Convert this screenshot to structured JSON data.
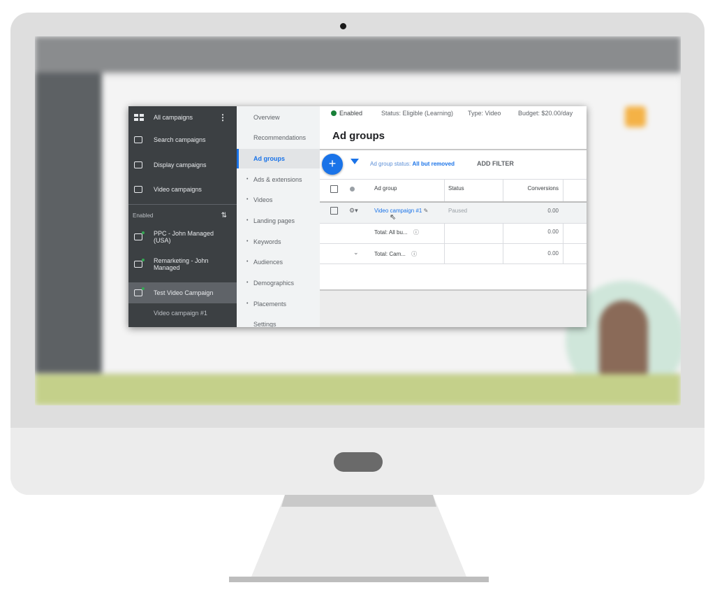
{
  "sidebar": {
    "all_campaigns": "All campaigns",
    "items": [
      {
        "label": "Search campaigns",
        "icon": "search-icon"
      },
      {
        "label": "Display campaigns",
        "icon": "display-icon"
      },
      {
        "label": "Video campaigns",
        "icon": "video-icon"
      }
    ],
    "section_label": "Enabled",
    "campaigns": [
      {
        "label": "PPC - John Managed (USA)",
        "icon": "search-icon"
      },
      {
        "label": "Remarketing - John Managed",
        "icon": "display-icon"
      },
      {
        "label": "Test Video Campaign",
        "icon": "video-icon"
      }
    ],
    "sub_item": "Video campaign #1"
  },
  "nav": {
    "items": [
      "Overview",
      "Recommendations",
      "Ad groups",
      "Ads & extensions",
      "Videos",
      "Landing pages",
      "Keywords",
      "Audiences",
      "Demographics",
      "Placements",
      "Settings"
    ],
    "active": "Ad groups"
  },
  "header": {
    "enabled": "Enabled",
    "status": "Status: Eligible (Learning)",
    "type": "Type: Video",
    "budget": "Budget: $20.00/day",
    "title": "Ad groups"
  },
  "filter": {
    "label": "Ad group status:",
    "value": "All but removed",
    "add": "ADD FILTER"
  },
  "table": {
    "columns": [
      "Ad group",
      "Status",
      "Conversions"
    ],
    "rows": [
      {
        "name": "Video campaign #1",
        "status": "Paused",
        "conversions": "0.00"
      },
      {
        "name": "Total: All bu...",
        "status": "",
        "conversions": "0.00"
      },
      {
        "name": "Total: Cam...",
        "status": "",
        "conversions": "0.00"
      }
    ]
  },
  "colors": {
    "accent": "#1a73e8",
    "sidebar": "#3c4043",
    "enabled": "#188038"
  }
}
